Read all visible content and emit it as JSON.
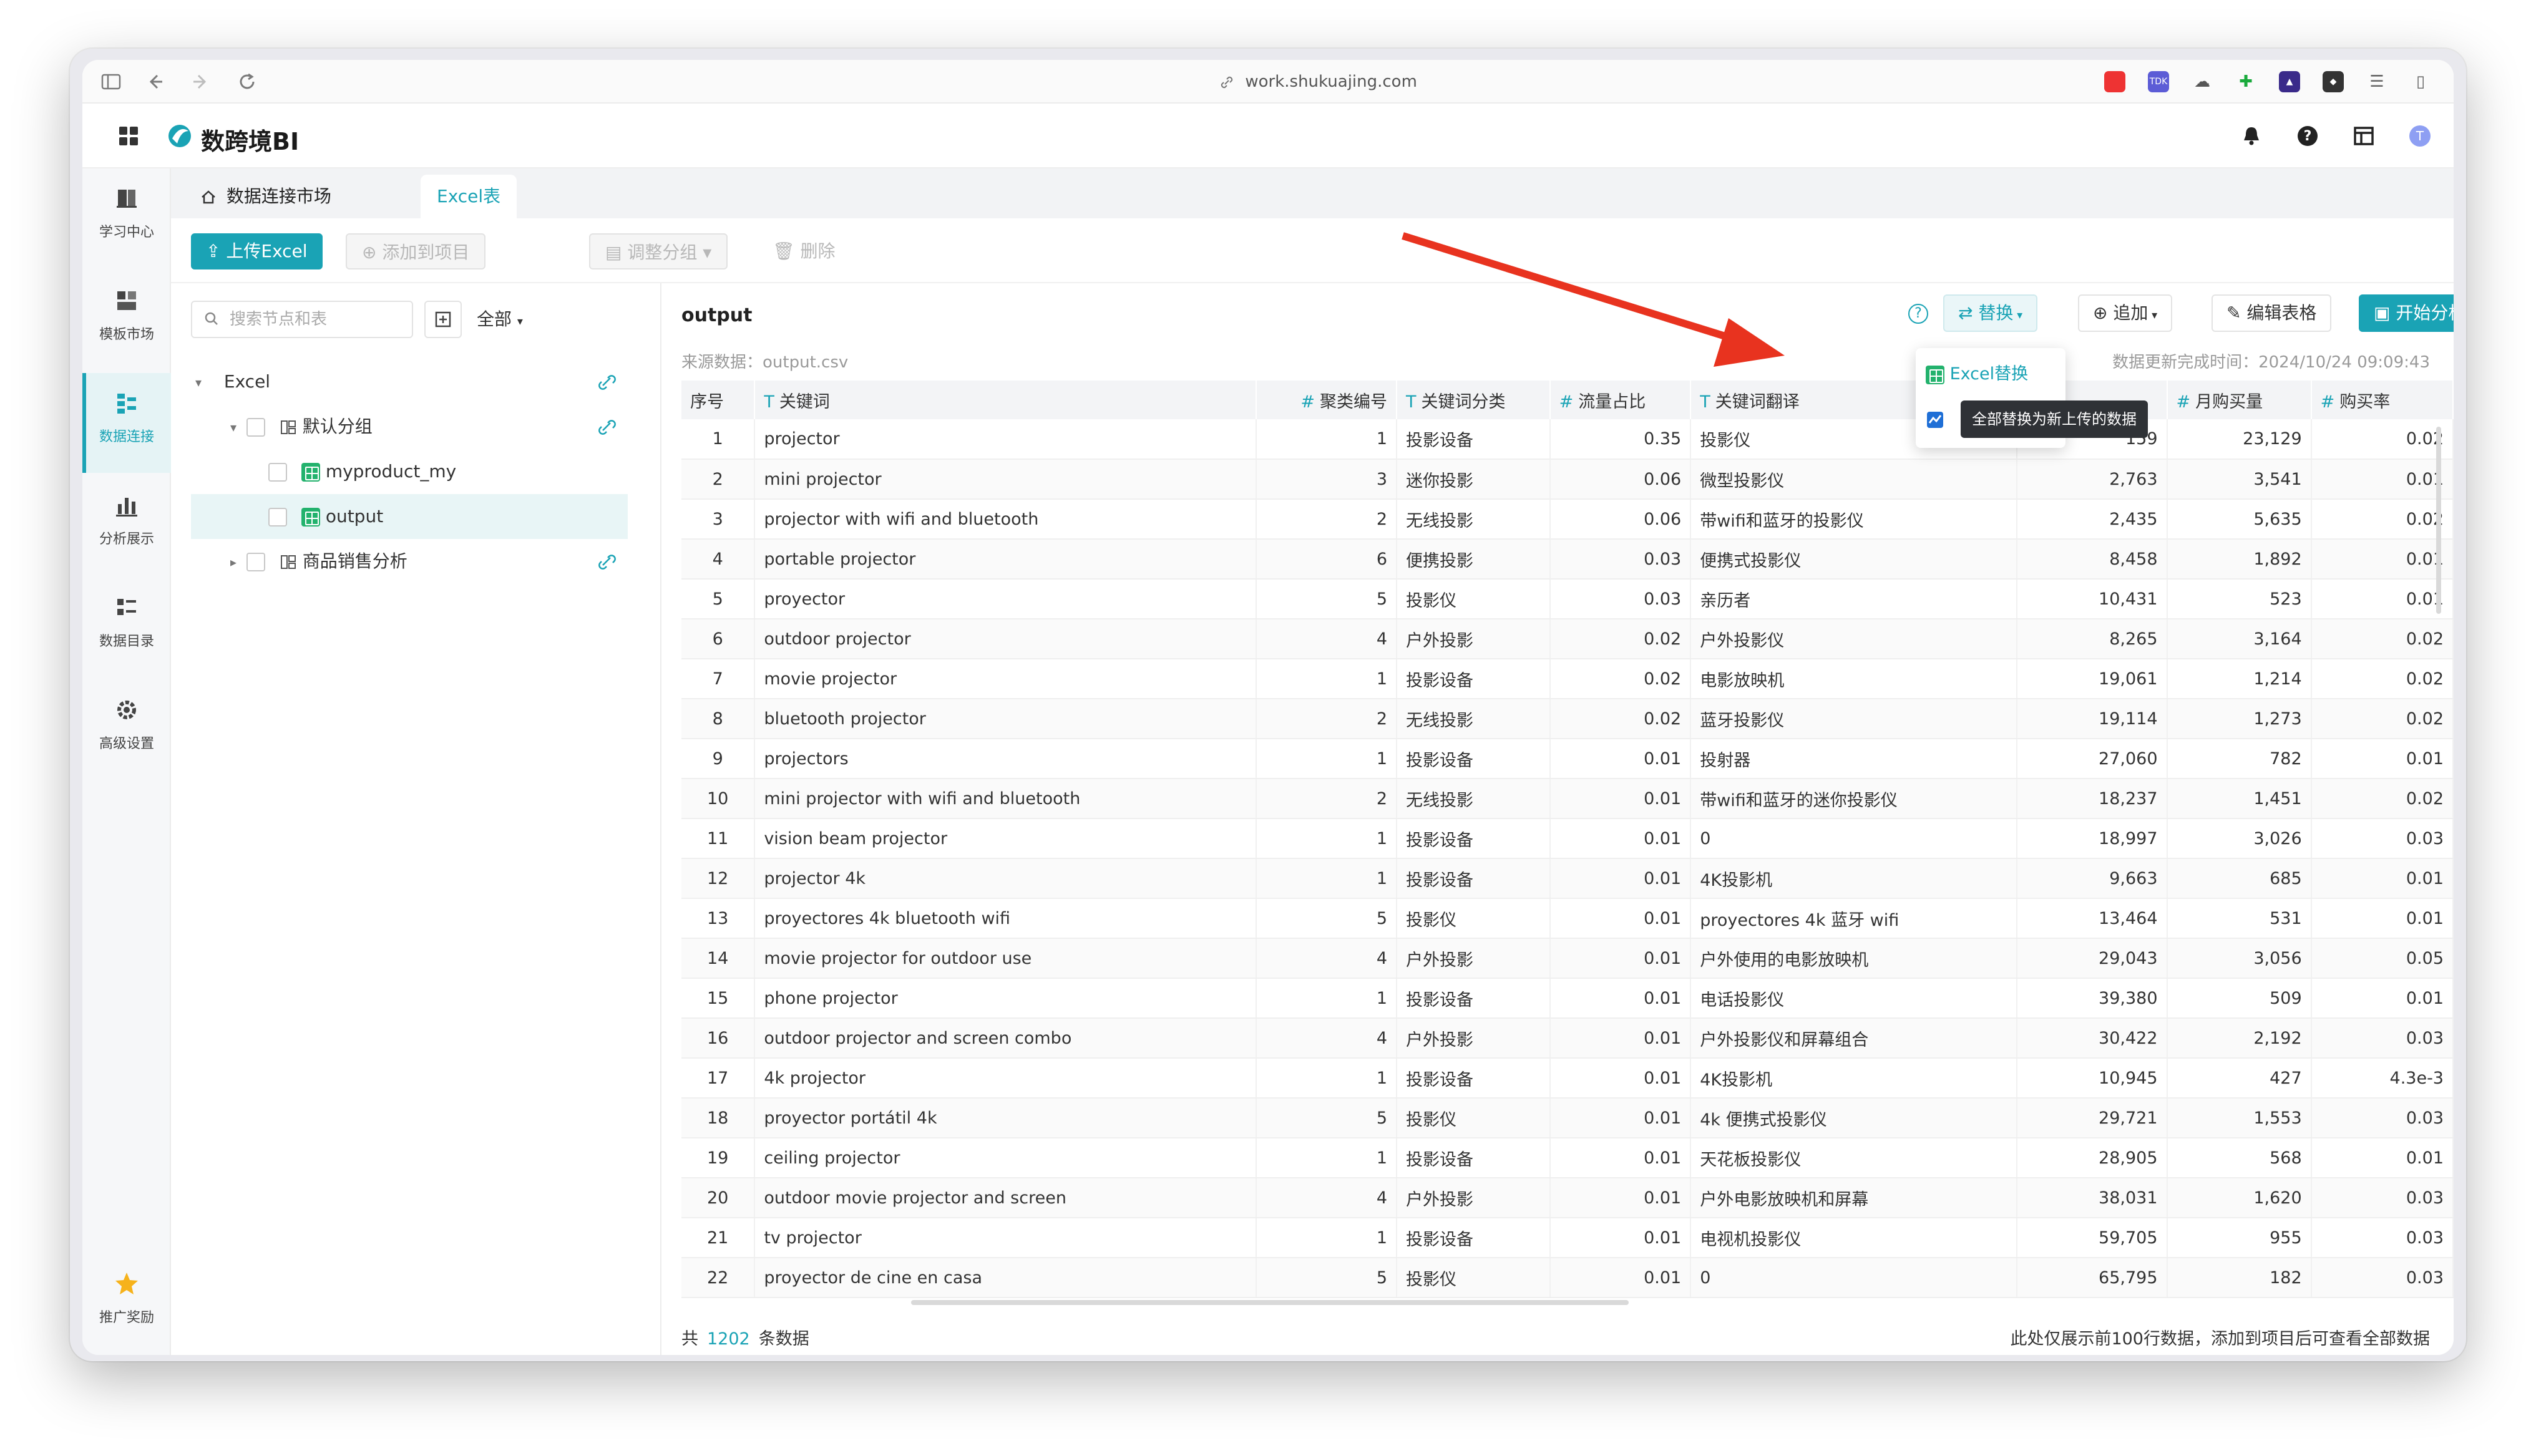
{
  "browser": {
    "url": "work.shukuajing.com"
  },
  "app": {
    "name": "数跨境BI"
  },
  "sidebar": {
    "items": [
      {
        "label": "学习中心",
        "icon": "book-icon"
      },
      {
        "label": "模板市场",
        "icon": "template-icon"
      },
      {
        "label": "数据连接",
        "icon": "data-connect-icon",
        "active": true
      },
      {
        "label": "分析展示",
        "icon": "chart-icon"
      },
      {
        "label": "数据目录",
        "icon": "catalog-icon"
      },
      {
        "label": "高级设置",
        "icon": "settings-icon"
      }
    ],
    "bottom": {
      "label": "推广奖励",
      "icon": "star-icon"
    }
  },
  "tabs": [
    {
      "label": "数据连接市场",
      "icon": "home-icon"
    },
    {
      "label": "Excel表",
      "active": true
    }
  ],
  "toolbar": {
    "upload": "上传Excel",
    "add_to_project": "添加到项目",
    "adjust_group": "调整分组",
    "delete": "删除"
  },
  "tree": {
    "search_placeholder": "搜索节点和表",
    "filter": "全部",
    "root": "Excel",
    "group_default": "默认分组",
    "table1": "myproduct_my",
    "table2": "output",
    "group_sales": "商品销售分析"
  },
  "main": {
    "title": "output",
    "source_label": "来源数据：",
    "source_file": "output.csv",
    "updated_label": "数据更新完成时间：",
    "updated_time": "2024/10/24 09:09:43",
    "btn_replace": "替换",
    "btn_append": "追加",
    "btn_edit": "编辑表格",
    "btn_analyze": "开始分析",
    "dropdown_excel": "Excel替换",
    "tooltip": "全部替换为新上传的数据"
  },
  "table": {
    "headers": [
      "序号",
      "关键词",
      "聚类编号",
      "关键词分类",
      "流量占比",
      "关键词翻译",
      "",
      "月购买量",
      "购买率"
    ],
    "rows": [
      [
        "1",
        "projector",
        "1",
        "投影设备",
        "0.35",
        "投影仪",
        "159",
        "23,129",
        "0.02"
      ],
      [
        "2",
        "mini projector",
        "3",
        "迷你投影",
        "0.06",
        "微型投影仪",
        "2,763",
        "3,541",
        "0.01"
      ],
      [
        "3",
        "projector with wifi and bluetooth",
        "2",
        "无线投影",
        "0.06",
        "带wifi和蓝牙的投影仪",
        "2,435",
        "5,635",
        "0.02"
      ],
      [
        "4",
        "portable projector",
        "6",
        "便携投影",
        "0.03",
        "便携式投影仪",
        "8,458",
        "1,892",
        "0.01"
      ],
      [
        "5",
        "proyector",
        "5",
        "投影仪",
        "0.03",
        "亲历者",
        "10,431",
        "523",
        "0.01"
      ],
      [
        "6",
        "outdoor projector",
        "4",
        "户外投影",
        "0.02",
        "户外投影仪",
        "8,265",
        "3,164",
        "0.02"
      ],
      [
        "7",
        "movie projector",
        "1",
        "投影设备",
        "0.02",
        "电影放映机",
        "19,061",
        "1,214",
        "0.02"
      ],
      [
        "8",
        "bluetooth projector",
        "2",
        "无线投影",
        "0.02",
        "蓝牙投影仪",
        "19,114",
        "1,273",
        "0.02"
      ],
      [
        "9",
        "projectors",
        "1",
        "投影设备",
        "0.01",
        "投射器",
        "27,060",
        "782",
        "0.01"
      ],
      [
        "10",
        "mini projector with wifi and bluetooth",
        "2",
        "无线投影",
        "0.01",
        "带wifi和蓝牙的迷你投影仪",
        "18,237",
        "1,451",
        "0.02"
      ],
      [
        "11",
        "vision beam projector",
        "1",
        "投影设备",
        "0.01",
        "0",
        "18,997",
        "3,026",
        "0.03"
      ],
      [
        "12",
        "projector 4k",
        "1",
        "投影设备",
        "0.01",
        "4K投影机",
        "9,663",
        "685",
        "0.01"
      ],
      [
        "13",
        "proyectores 4k bluetooth wifi",
        "5",
        "投影仪",
        "0.01",
        "proyectores 4k 蓝牙 wifi",
        "13,464",
        "531",
        "0.01"
      ],
      [
        "14",
        "movie projector for outdoor use",
        "4",
        "户外投影",
        "0.01",
        "户外使用的电影放映机",
        "29,043",
        "3,056",
        "0.05"
      ],
      [
        "15",
        "phone projector",
        "1",
        "投影设备",
        "0.01",
        "电话投影仪",
        "39,380",
        "509",
        "0.01"
      ],
      [
        "16",
        "outdoor projector and screen combo",
        "4",
        "户外投影",
        "0.01",
        "户外投影仪和屏幕组合",
        "30,422",
        "2,192",
        "0.03"
      ],
      [
        "17",
        "4k projector",
        "1",
        "投影设备",
        "0.01",
        "4K投影机",
        "10,945",
        "427",
        "4.3e-3"
      ],
      [
        "18",
        "proyector portátil 4k",
        "5",
        "投影仪",
        "0.01",
        "4k 便携式投影仪",
        "29,721",
        "1,553",
        "0.03"
      ],
      [
        "19",
        "ceiling projector",
        "1",
        "投影设备",
        "0.01",
        "天花板投影仪",
        "28,905",
        "568",
        "0.01"
      ],
      [
        "20",
        "outdoor movie projector and screen",
        "4",
        "户外投影",
        "0.01",
        "户外电影放映机和屏幕",
        "38,031",
        "1,620",
        "0.03"
      ],
      [
        "21",
        "tv projector",
        "1",
        "投影设备",
        "0.01",
        "电视机投影仪",
        "59,705",
        "955",
        "0.03"
      ],
      [
        "22",
        "proyector de cine en casa",
        "5",
        "投影仪",
        "0.01",
        "0",
        "65,795",
        "182",
        "0.03"
      ]
    ]
  },
  "footer": {
    "total_prefix": "共",
    "total_count": "1202",
    "total_suffix": "条数据",
    "note": "此处仅展示前100行数据，添加到项目后可查看全部数据"
  },
  "colors": {
    "accent": "#1aa3b5",
    "arrow": "#e8331f",
    "excel_green": "#23b26d"
  }
}
